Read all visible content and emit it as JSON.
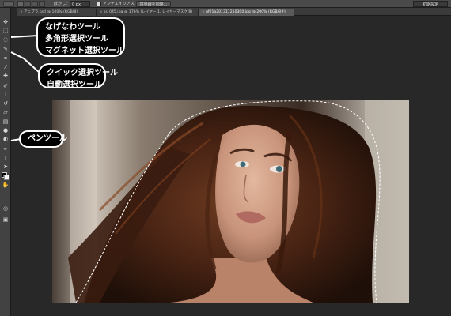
{
  "options_bar": {
    "feather_label": "ぼかし：",
    "feather_value": "0 px",
    "antialias_label": "アンチエイリアス",
    "refine_button": "境界線を調整...",
    "workspace_label": "初期設定"
  },
  "tabs": [
    {
      "label": "アニプラ.psd @ 100% (RGB/8)"
    },
    {
      "label": "ss_045.jpg @ 176% (レイヤー 1, レイヤーマスク/8)"
    },
    {
      "label": "gf01a201311250300.jpg @ 200% (RGB/8#)"
    }
  ],
  "callouts": {
    "lasso": [
      "なげなわツール",
      "多角形選択ツール",
      "マグネット選択ツール"
    ],
    "quick": [
      "クイック選択ツール",
      "自動選択ツール"
    ],
    "pen": [
      "ペンツール"
    ]
  },
  "tools": [
    {
      "name": "move-tool-icon",
      "glyph": "✥"
    },
    {
      "name": "marquee-tool-icon",
      "glyph": "⬚"
    },
    {
      "name": "lasso-tool-icon",
      "glyph": "◌"
    },
    {
      "name": "quick-select-tool-icon",
      "glyph": "✎"
    },
    {
      "name": "crop-tool-icon",
      "glyph": "⌗"
    },
    {
      "name": "eyedropper-tool-icon",
      "glyph": "⁄"
    },
    {
      "name": "healing-brush-tool-icon",
      "glyph": "✚"
    },
    {
      "name": "brush-tool-icon",
      "glyph": "✐"
    },
    {
      "name": "clone-stamp-tool-icon",
      "glyph": "⊥"
    },
    {
      "name": "history-brush-tool-icon",
      "glyph": "↺"
    },
    {
      "name": "eraser-tool-icon",
      "glyph": "▱"
    },
    {
      "name": "gradient-tool-icon",
      "glyph": "▤"
    },
    {
      "name": "blur-tool-icon",
      "glyph": "●"
    },
    {
      "name": "dodge-tool-icon",
      "glyph": "◐"
    },
    {
      "name": "pen-tool-icon",
      "glyph": "✒"
    },
    {
      "name": "type-tool-icon",
      "glyph": "T"
    },
    {
      "name": "path-selection-tool-icon",
      "glyph": "➤"
    },
    {
      "name": "shape-tool-icon",
      "glyph": "▭"
    },
    {
      "name": "hand-tool-icon",
      "glyph": "✋"
    },
    {
      "name": "zoom-tool-icon",
      "glyph": "⌕"
    },
    {
      "name": "quick-mask-icon",
      "glyph": "◎"
    },
    {
      "name": "screen-mode-icon",
      "glyph": "▣"
    }
  ]
}
